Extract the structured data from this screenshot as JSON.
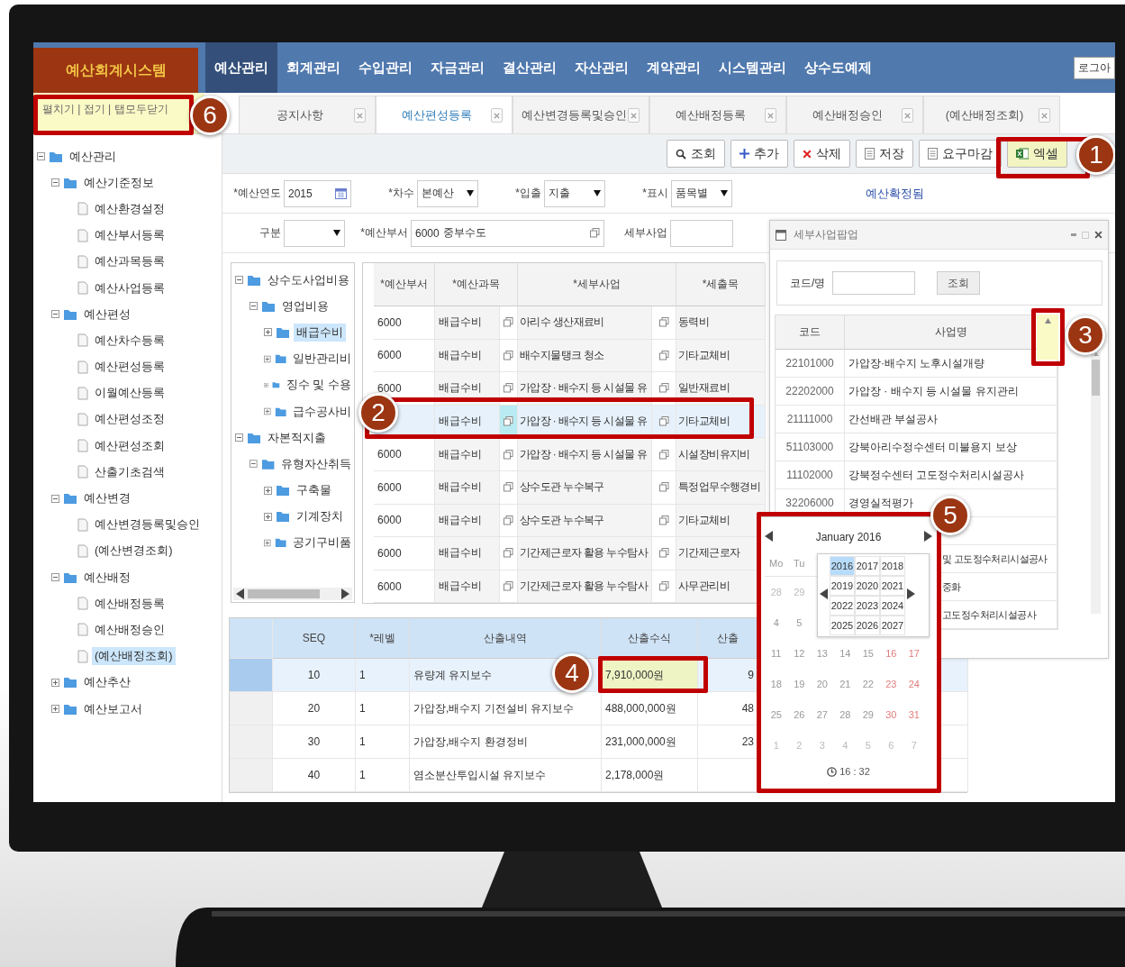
{
  "app_bar": {
    "logo": "예산회계시스템",
    "menu": [
      {
        "label": "예산관리",
        "selected": true
      },
      {
        "label": "회계관리",
        "selected": false
      },
      {
        "label": "수입관리",
        "selected": false
      },
      {
        "label": "자금관리",
        "selected": false
      },
      {
        "label": "결산관리",
        "selected": false
      },
      {
        "label": "자산관리",
        "selected": false
      },
      {
        "label": "계약관리",
        "selected": false
      },
      {
        "label": "시스템관리",
        "selected": false
      },
      {
        "label": "상수도예제",
        "selected": false
      }
    ],
    "logout": "로그아"
  },
  "tree_actions": "펼치기 | 접기 | 탭모두닫기",
  "tabs": [
    {
      "label": "공지사항",
      "selected": false
    },
    {
      "label": "예산편성등록",
      "selected": true
    },
    {
      "label": "예산변경등록및승인",
      "selected": false
    },
    {
      "label": "예산배정등록",
      "selected": false
    },
    {
      "label": "예산배정승인",
      "selected": false
    },
    {
      "label": "(예산배정조회)",
      "selected": false
    }
  ],
  "sidebar": {
    "tree": [
      {
        "label": "예산관리",
        "kind": "folder",
        "expanded": true,
        "selected": false,
        "children": [
          {
            "label": "예산기준정보",
            "kind": "folder",
            "expanded": true,
            "selected": false,
            "children": [
              {
                "label": "예산환경설정",
                "kind": "page",
                "selected": false
              },
              {
                "label": "예산부서등록",
                "kind": "page",
                "selected": false
              },
              {
                "label": "예산과목등록",
                "kind": "page",
                "selected": false
              },
              {
                "label": "예산사업등록",
                "kind": "page",
                "selected": false
              }
            ]
          },
          {
            "label": "예산편성",
            "kind": "folder",
            "expanded": true,
            "selected": false,
            "children": [
              {
                "label": "예산차수등록",
                "kind": "page",
                "selected": false
              },
              {
                "label": "예산편성등록",
                "kind": "page",
                "selected": false
              },
              {
                "label": "이월예산등록",
                "kind": "page",
                "selected": false
              },
              {
                "label": "예산편성조정",
                "kind": "page",
                "selected": false
              },
              {
                "label": "예산편성조회",
                "kind": "page",
                "selected": false
              },
              {
                "label": "산출기초검색",
                "kind": "page",
                "selected": false
              }
            ]
          },
          {
            "label": "예산변경",
            "kind": "folder",
            "expanded": true,
            "selected": false,
            "children": [
              {
                "label": "예산변경등록및승인",
                "kind": "page",
                "selected": false
              },
              {
                "label": "(예산변경조회)",
                "kind": "page",
                "selected": false
              }
            ]
          },
          {
            "label": "예산배정",
            "kind": "folder",
            "expanded": true,
            "selected": false,
            "children": [
              {
                "label": "예산배정등록",
                "kind": "page",
                "selected": false
              },
              {
                "label": "예산배정승인",
                "kind": "page",
                "selected": false
              },
              {
                "label": "(예산배정조회)",
                "kind": "page",
                "selected": true
              }
            ]
          },
          {
            "label": "예산추산",
            "kind": "folder",
            "expanded": false,
            "selected": false
          },
          {
            "label": "예산보고서",
            "kind": "folder",
            "expanded": false,
            "selected": false
          }
        ]
      }
    ]
  },
  "toolbar": [
    {
      "label": "조회",
      "kind": "search",
      "highlighted": false
    },
    {
      "label": "추가",
      "kind": "add",
      "highlighted": false
    },
    {
      "label": "삭제",
      "kind": "delete",
      "highlighted": false
    },
    {
      "label": "저장",
      "kind": "save",
      "highlighted": false
    },
    {
      "label": "요구마감",
      "kind": "document",
      "highlighted": false
    },
    {
      "label": "엑셀",
      "kind": "excel",
      "highlighted": true
    }
  ],
  "filters": [
    [
      {
        "label": "*예산연도",
        "value": "2015",
        "kind": "date"
      },
      {
        "label": "*차수",
        "value": "본예산",
        "kind": "select"
      },
      {
        "label": "*입출",
        "value": "지출",
        "kind": "select"
      },
      {
        "label": "*표시",
        "value": "품목별",
        "kind": "select"
      }
    ],
    [
      {
        "label": "구분",
        "kind": "select"
      },
      {
        "label": "*예산부서",
        "code": "6000",
        "value": "중부수도",
        "kind": "code"
      },
      {
        "label": "세부사업",
        "kind": "text"
      }
    ]
  ],
  "status_link": "예산확정됨",
  "account_tree": [
    {
      "label": "상수도사업비용",
      "kind": "folder",
      "expanded": true,
      "selected": false,
      "children": [
        {
          "label": "영업비용",
          "kind": "folder",
          "expanded": true,
          "selected": false,
          "children": [
            {
              "label": "배급수비",
              "kind": "folder",
              "expanded": false,
              "selected": true
            },
            {
              "label": "일반관리비",
              "kind": "folder",
              "expanded": false,
              "selected": false
            },
            {
              "label": "징수 및 수용",
              "kind": "folder",
              "expanded": false,
              "selected": false
            },
            {
              "label": "급수공사비",
              "kind": "folder",
              "expanded": false,
              "selected": false
            }
          ]
        }
      ]
    },
    {
      "label": "자본적지출",
      "kind": "folder",
      "expanded": true,
      "selected": false,
      "children": [
        {
          "label": "유형자산취득",
          "kind": "folder",
          "expanded": true,
          "selected": false,
          "children": [
            {
              "label": "구축물",
              "kind": "folder",
              "expanded": false,
              "selected": false
            },
            {
              "label": "기계장치",
              "kind": "folder",
              "expanded": false,
              "selected": false
            },
            {
              "label": "공기구비품",
              "kind": "folder",
              "expanded": false,
              "selected": false
            }
          ]
        }
      ]
    }
  ],
  "budget_grid": {
    "columns": [
      "*예산부서",
      "*예산과목",
      "*세부사업",
      "*세출목"
    ],
    "rows": [
      {
        "dept": "6000",
        "subject": "배급수비",
        "project": "아리수 생산재료비",
        "item": "동력비",
        "selected": false
      },
      {
        "dept": "6000",
        "subject": "배급수비",
        "project": "배수지물탱크 청소",
        "item": "기타교체비",
        "selected": false
      },
      {
        "dept": "6000",
        "subject": "배급수비",
        "project": "가압장 · 배수지 등 시설물 유",
        "item": "일반재료비",
        "selected": false
      },
      {
        "subject": "배급수비",
        "project": "가압장 · 배수지 등 시설물 유",
        "item": "기타교체비",
        "selected": true
      },
      {
        "dept": "6000",
        "subject": "배급수비",
        "project": "가압장 · 배수지 등 시설물 유",
        "item": "시설장비유지비",
        "selected": false
      },
      {
        "dept": "6000",
        "subject": "배급수비",
        "project": "상수도관 누수복구",
        "item": "특정업무수행경비",
        "selected": false
      },
      {
        "dept": "6000",
        "subject": "배급수비",
        "project": "상수도관 누수복구",
        "item": "기타교체비",
        "selected": false
      },
      {
        "dept": "6000",
        "subject": "배급수비",
        "project": "기간제근로자 활용 누수탐사",
        "item": "기간제근로자",
        "selected": false
      },
      {
        "dept": "6000",
        "subject": "배급수비",
        "project": "기간제근로자 활용 누수탐사",
        "item": "사무관리비",
        "selected": false
      }
    ]
  },
  "calc_grid": {
    "columns": [
      "SEQ",
      "*레벨",
      "산출내역",
      "산출수식",
      "산출"
    ],
    "rows": [
      {
        "seq": "10",
        "tier": "1",
        "detail": "유량계 유지보수",
        "formula": "7,910,000원",
        "amount": "9",
        "selected": true,
        "formula_highlighted": true
      },
      {
        "seq": "20",
        "tier": "1",
        "detail": "가압장,배수지 기전설비 유지보수",
        "formula": "488,000,000원",
        "amount": "48",
        "selected": false,
        "formula_highlighted": false
      },
      {
        "seq": "30",
        "tier": "1",
        "detail": "가압장,배수지 환경정비",
        "formula": "231,000,000원",
        "amount": "23",
        "selected": false,
        "formula_highlighted": false
      },
      {
        "seq": "40",
        "tier": "1",
        "detail": "염소분산투입시설 유지보수",
        "formula": "2,178,000원",
        "selected": false,
        "formula_highlighted": false
      }
    ]
  },
  "popup": {
    "title": "세부사업팝업",
    "search_label": "코드/명",
    "search_button": "조회",
    "columns": [
      "코드",
      "사업명"
    ],
    "rows": [
      {
        "code": "22101000",
        "name": "가압장·배수지 노후시설개량"
      },
      {
        "code": "22202000",
        "name": "가압장 · 배수지 등 시설물 유지관리"
      },
      {
        "code": "21111000",
        "name": "간선배관 부설공사"
      },
      {
        "code": "51103000",
        "name": "강북아리수정수센터 미불용지 보상"
      },
      {
        "code": "11102000",
        "name": "강북정수센터 고도정수처리시설공사"
      },
      {
        "code": "32206000",
        "name": "경영실적평가"
      },
      {
        "name": "및 고도정수처리시설공사"
      },
      {
        "name": "중화"
      },
      {
        "name": "고도정수처리시설공사"
      }
    ]
  },
  "calendar": {
    "month": "January 2016",
    "weekdays": [
      "Mo",
      "Tu"
    ],
    "weeks": [
      [
        {
          "day": "28",
          "kind": "other"
        },
        {
          "day": "29",
          "kind": "other"
        }
      ],
      [
        {
          "day": "4",
          "kind": "weekday"
        },
        {
          "day": "5",
          "kind": "weekday"
        }
      ],
      [
        {
          "day": "11",
          "kind": "weekday"
        },
        {
          "day": "12",
          "kind": "weekday"
        },
        {
          "day": "13",
          "kind": "weekday"
        },
        {
          "day": "14",
          "kind": "weekday"
        },
        {
          "day": "15",
          "kind": "weekday"
        },
        {
          "day": "16",
          "kind": "weekend"
        },
        {
          "day": "17",
          "kind": "weekend"
        }
      ],
      [
        {
          "day": "18",
          "kind": "weekday"
        },
        {
          "day": "19",
          "kind": "weekday"
        },
        {
          "day": "20",
          "kind": "weekday"
        },
        {
          "day": "21",
          "kind": "weekday"
        },
        {
          "day": "22",
          "kind": "weekday"
        },
        {
          "day": "23",
          "kind": "weekend"
        },
        {
          "day": "24",
          "kind": "weekend"
        }
      ],
      [
        {
          "day": "25",
          "kind": "weekday"
        },
        {
          "day": "26",
          "kind": "weekday"
        },
        {
          "day": "27",
          "kind": "weekday"
        },
        {
          "day": "28",
          "kind": "weekday"
        },
        {
          "day": "29",
          "kind": "weekday"
        },
        {
          "day": "30",
          "kind": "weekend"
        },
        {
          "day": "31",
          "kind": "weekend"
        }
      ],
      [
        {
          "day": "1",
          "kind": "other"
        },
        {
          "day": "2",
          "kind": "other"
        },
        {
          "day": "3",
          "kind": "other"
        },
        {
          "day": "4",
          "kind": "other"
        },
        {
          "day": "5",
          "kind": "other"
        },
        {
          "day": "6",
          "kind": "other"
        },
        {
          "day": "7",
          "kind": "other"
        }
      ]
    ],
    "years": [
      {
        "label": "2016",
        "selected": true
      },
      {
        "label": "2017",
        "selected": false
      },
      {
        "label": "2018",
        "selected": false
      },
      {
        "label": "2019",
        "selected": false
      },
      {
        "label": "2020",
        "selected": false
      },
      {
        "label": "2021",
        "selected": false
      },
      {
        "label": "2022",
        "selected": false
      },
      {
        "label": "2023",
        "selected": false
      },
      {
        "label": "2024",
        "selected": false
      },
      {
        "label": "2025",
        "selected": false
      },
      {
        "label": "2026",
        "selected": false
      },
      {
        "label": "2027",
        "selected": false
      }
    ],
    "time": "16 : 32"
  },
  "annotations": [
    {
      "number": "1"
    },
    {
      "number": "2"
    },
    {
      "number": "3"
    },
    {
      "number": "4"
    },
    {
      "number": "5"
    },
    {
      "number": "6"
    }
  ]
}
